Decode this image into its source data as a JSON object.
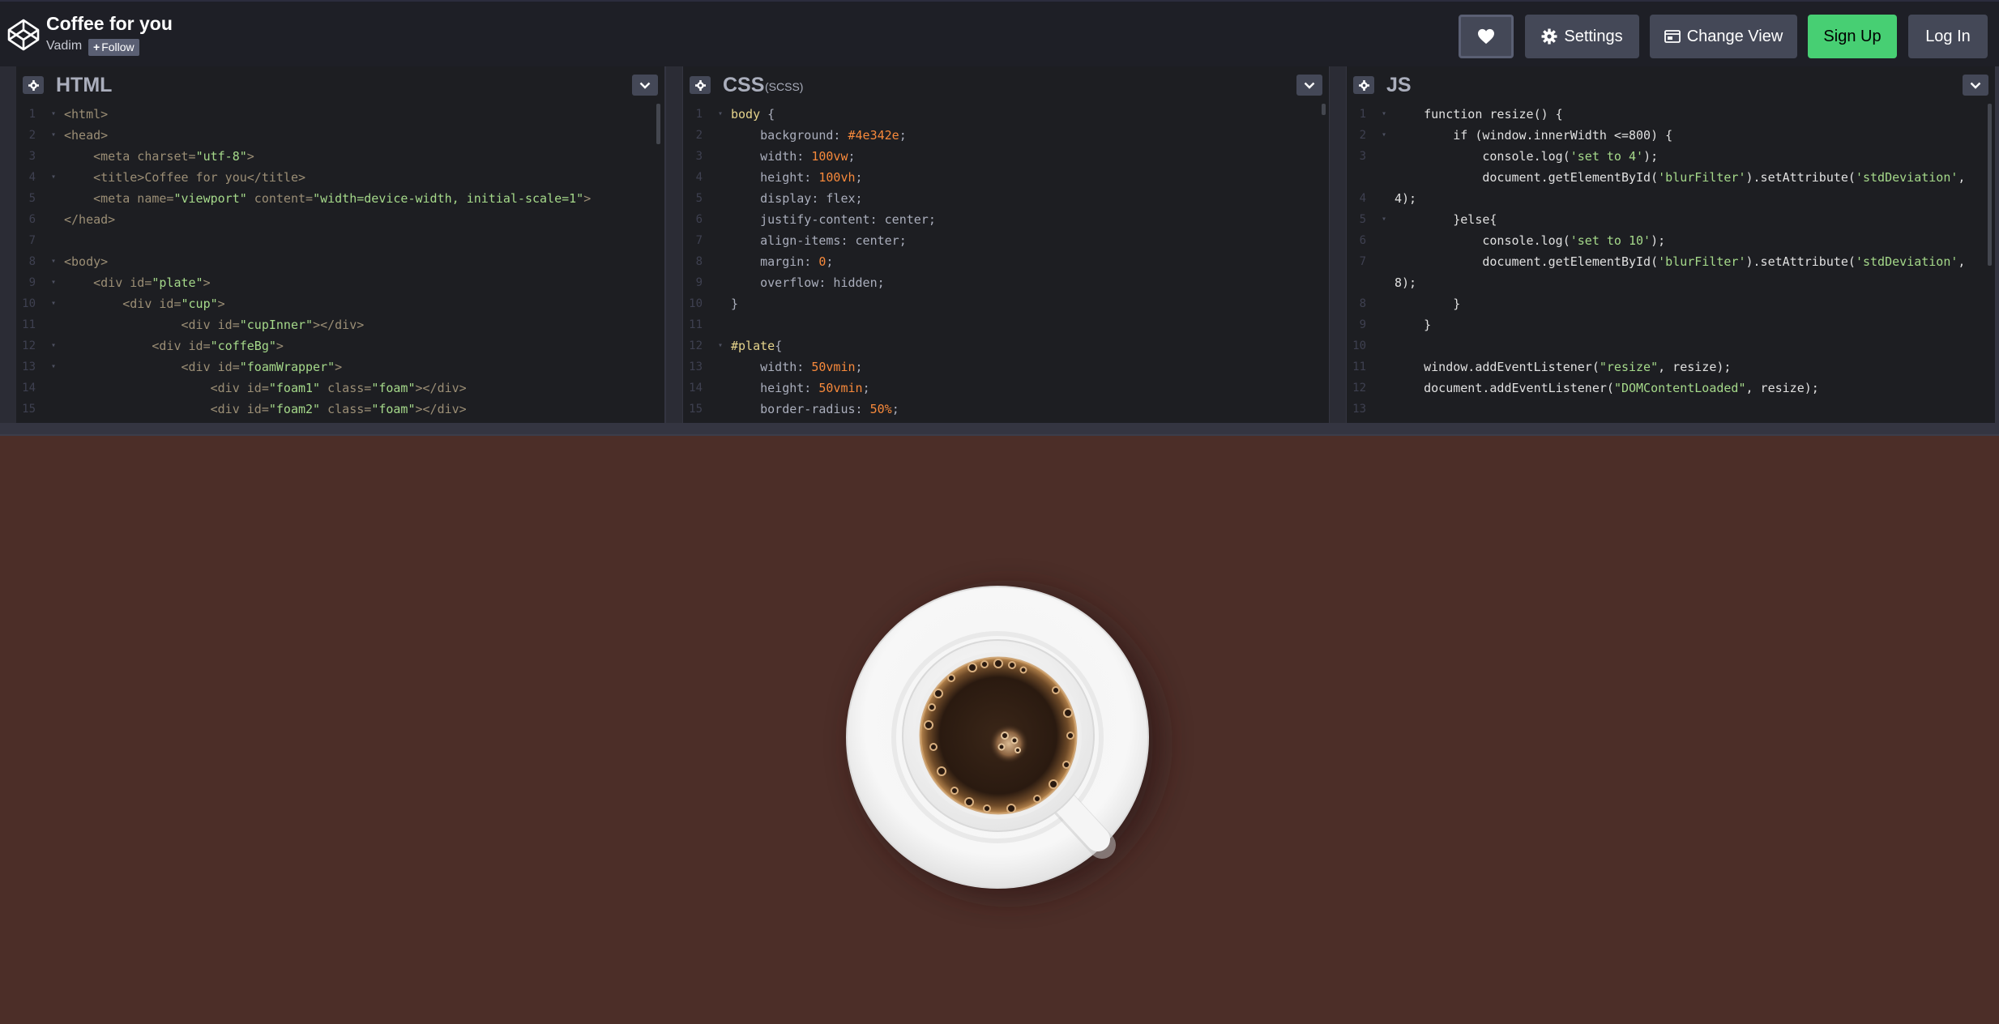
{
  "header": {
    "title": "Coffee for you",
    "author": "Vadim",
    "follow_label": "Follow",
    "follow_plus": "+",
    "buttons": {
      "settings": "Settings",
      "change_view": "Change View",
      "sign_up": "Sign Up",
      "log_in": "Log In"
    },
    "icons": [
      "codepen-logo-icon",
      "heart-icon",
      "gear-icon",
      "layout-icon"
    ]
  },
  "editors": {
    "html": {
      "title": "HTML",
      "lines": [
        {
          "n": "1",
          "fold": "▾",
          "code": "<html>"
        },
        {
          "n": "2",
          "fold": "▾",
          "code": "<head>"
        },
        {
          "n": "3",
          "fold": "",
          "code": "    <meta charset=\"utf-8\">"
        },
        {
          "n": "4",
          "fold": "▾",
          "code": "    <title>Coffee for you</title>"
        },
        {
          "n": "5",
          "fold": "",
          "code": "    <meta name=\"viewport\" content=\"width=device-width, initial-scale=1\">"
        },
        {
          "n": "6",
          "fold": "",
          "code": "</head>"
        },
        {
          "n": "7",
          "fold": "",
          "code": ""
        },
        {
          "n": "8",
          "fold": "▾",
          "code": "<body>"
        },
        {
          "n": "9",
          "fold": "▾",
          "code": "    <div id=\"plate\">"
        },
        {
          "n": "10",
          "fold": "▾",
          "code": "        <div id=\"cup\">"
        },
        {
          "n": "11",
          "fold": "",
          "code": "                <div id=\"cupInner\"></div>"
        },
        {
          "n": "12",
          "fold": "▾",
          "code": "            <div id=\"coffeBg\">"
        },
        {
          "n": "13",
          "fold": "▾",
          "code": "                <div id=\"foamWrapper\">"
        },
        {
          "n": "14",
          "fold": "",
          "code": "                    <div id=\"foam1\" class=\"foam\"></div>"
        },
        {
          "n": "15",
          "fold": "",
          "code": "                    <div id=\"foam2\" class=\"foam\"></div>"
        }
      ]
    },
    "css": {
      "title": "CSS",
      "subtitle": "(SCSS)",
      "lines": [
        {
          "n": "1",
          "fold": "▾",
          "code": "body {"
        },
        {
          "n": "2",
          "fold": "",
          "code": "    background: #4e342e;"
        },
        {
          "n": "3",
          "fold": "",
          "code": "    width: 100vw;"
        },
        {
          "n": "4",
          "fold": "",
          "code": "    height: 100vh;"
        },
        {
          "n": "5",
          "fold": "",
          "code": "    display: flex;"
        },
        {
          "n": "6",
          "fold": "",
          "code": "    justify-content: center;"
        },
        {
          "n": "7",
          "fold": "",
          "code": "    align-items: center;"
        },
        {
          "n": "8",
          "fold": "",
          "code": "    margin: 0;"
        },
        {
          "n": "9",
          "fold": "",
          "code": "    overflow: hidden;"
        },
        {
          "n": "10",
          "fold": "",
          "code": "}"
        },
        {
          "n": "11",
          "fold": "",
          "code": ""
        },
        {
          "n": "12",
          "fold": "▾",
          "code": "#plate{"
        },
        {
          "n": "13",
          "fold": "",
          "code": "    width: 50vmin;"
        },
        {
          "n": "14",
          "fold": "",
          "code": "    height: 50vmin;"
        },
        {
          "n": "15",
          "fold": "",
          "code": "    border-radius: 50%;"
        }
      ]
    },
    "js": {
      "title": "JS",
      "lines": [
        {
          "n": "1",
          "fold": "▾",
          "code": "    function resize() {"
        },
        {
          "n": "2",
          "fold": "▾",
          "code": "        if (window.innerWidth <=800) {"
        },
        {
          "n": "3",
          "fold": "",
          "code": "            console.log('set to 4');"
        },
        {
          "n": "",
          "fold": "",
          "code": "            document.getElementById('blurFilter').setAttribute('stdDeviation',"
        },
        {
          "n": "4",
          "fold": "",
          "code": "4);"
        },
        {
          "n": "5",
          "fold": "▾",
          "code": "        }else{"
        },
        {
          "n": "6",
          "fold": "",
          "code": "            console.log('set to 10');"
        },
        {
          "n": "7",
          "fold": "",
          "code": "            document.getElementById('blurFilter').setAttribute('stdDeviation',"
        },
        {
          "n": "",
          "fold": "",
          "code": "8);"
        },
        {
          "n": "8",
          "fold": "",
          "code": "        }"
        },
        {
          "n": "9",
          "fold": "",
          "code": "    }"
        },
        {
          "n": "10",
          "fold": "",
          "code": ""
        },
        {
          "n": "11",
          "fold": "",
          "code": "    window.addEventListener(\"resize\", resize);"
        },
        {
          "n": "12",
          "fold": "",
          "code": "    document.addEventListener(\"DOMContentLoaded\", resize);"
        },
        {
          "n": "13",
          "fold": "",
          "code": ""
        }
      ]
    }
  },
  "colors": {
    "preview_background": "#4c2e28",
    "header_background": "#1e1f26",
    "sign_up": "#47cf73"
  }
}
